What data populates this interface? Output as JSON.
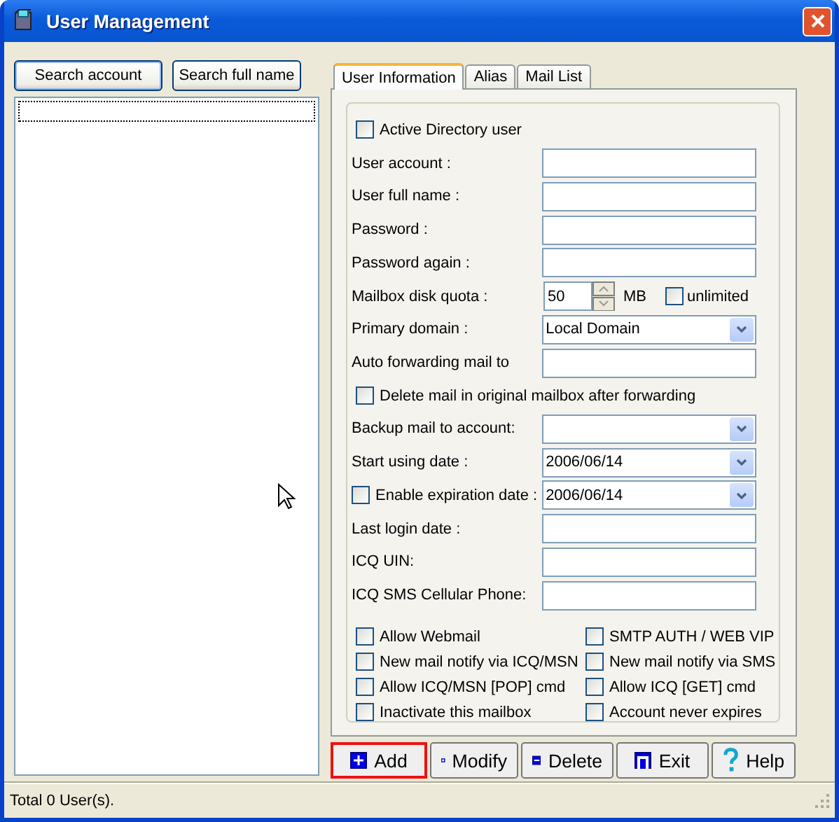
{
  "window": {
    "title": "User Management"
  },
  "search_buttons": [
    "Search account",
    "Search full name"
  ],
  "tabs": [
    {
      "label": "User Information",
      "selected": true
    },
    {
      "label": "Alias",
      "selected": false
    },
    {
      "label": "Mail List",
      "selected": false
    }
  ],
  "form": [
    {
      "kind": "checkbox",
      "label": "Active Directory user",
      "checked": false
    },
    {
      "kind": "text",
      "label": "User account :"
    },
    {
      "kind": "text",
      "label": "User full name :"
    },
    {
      "kind": "text",
      "label": "Password :"
    },
    {
      "kind": "text",
      "label": "Password again :"
    },
    {
      "kind": "spin",
      "label": "Mailbox disk quota :",
      "value": "50",
      "unit": "MB",
      "option": {
        "label": "unlimited",
        "checked": false
      }
    },
    {
      "kind": "select",
      "label": "Primary domain :",
      "value": "Local Domain"
    },
    {
      "kind": "text",
      "label": "Auto forwarding mail to"
    },
    {
      "kind": "checkbox",
      "label": "Delete mail in original mailbox after forwarding",
      "checked": false
    },
    {
      "kind": "select",
      "label": "Backup mail to account:"
    },
    {
      "kind": "select",
      "label": "Start using date :",
      "value": "2006/06/14"
    },
    {
      "kind": "checkselect",
      "label": "Enable expiration date :",
      "checked": false,
      "value": "2006/06/14"
    },
    {
      "kind": "text",
      "label": "Last login date :"
    },
    {
      "kind": "text",
      "label": "ICQ UIN:"
    },
    {
      "kind": "text",
      "label": "ICQ SMS Cellular Phone:"
    }
  ],
  "options": [
    {
      "label": "Allow Webmail",
      "checked": false
    },
    {
      "label": "SMTP AUTH / WEB VIP",
      "checked": false
    },
    {
      "label": "New mail notify via ICQ/MSN",
      "checked": false
    },
    {
      "label": "New mail notify via SMS",
      "checked": false
    },
    {
      "label": "Allow ICQ/MSN [POP]  cmd",
      "checked": false
    },
    {
      "label": "Allow ICQ [GET] cmd",
      "checked": false
    },
    {
      "label": "Inactivate this mailbox",
      "checked": false
    },
    {
      "label": "Account never expires",
      "checked": false
    }
  ],
  "buttons": [
    {
      "label": "Add",
      "highlighted": true
    },
    {
      "label": "Modify",
      "highlighted": false
    },
    {
      "label": "Delete",
      "highlighted": false
    },
    {
      "label": "Exit",
      "highlighted": false
    },
    {
      "label": "Help",
      "highlighted": false
    }
  ],
  "status_bar": "Total 0 User(s)."
}
